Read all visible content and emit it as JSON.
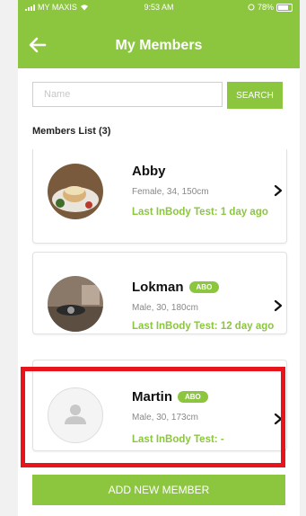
{
  "status_bar": {
    "carrier": "MY MAXIS",
    "time": "9:53 AM",
    "battery": "78%"
  },
  "header": {
    "title": "My Members",
    "back_icon": "arrow-left-icon"
  },
  "search": {
    "placeholder": "Name",
    "value": "",
    "button_label": "SEARCH"
  },
  "members_list": {
    "title": "Members List (3)",
    "members": [
      {
        "name": "Abby",
        "badge": "",
        "info": "Female, 34, 150cm",
        "last_test": "Last InBody Test: 1 day ago",
        "avatar": "photo"
      },
      {
        "name": "Lokman",
        "badge": "ABO",
        "info": "Male, 30, 180cm",
        "last_test": "Last InBody Test: 12 day ago",
        "avatar": "photo"
      },
      {
        "name": "Martin",
        "badge": "ABO",
        "info": "Male, 30, 173cm",
        "last_test": "Last InBody Test: -",
        "avatar": "default-person-icon"
      }
    ]
  },
  "add_button": {
    "label": "ADD NEW MEMBER"
  },
  "colors": {
    "accent": "#8cc63f",
    "highlight": "#e8141b"
  }
}
